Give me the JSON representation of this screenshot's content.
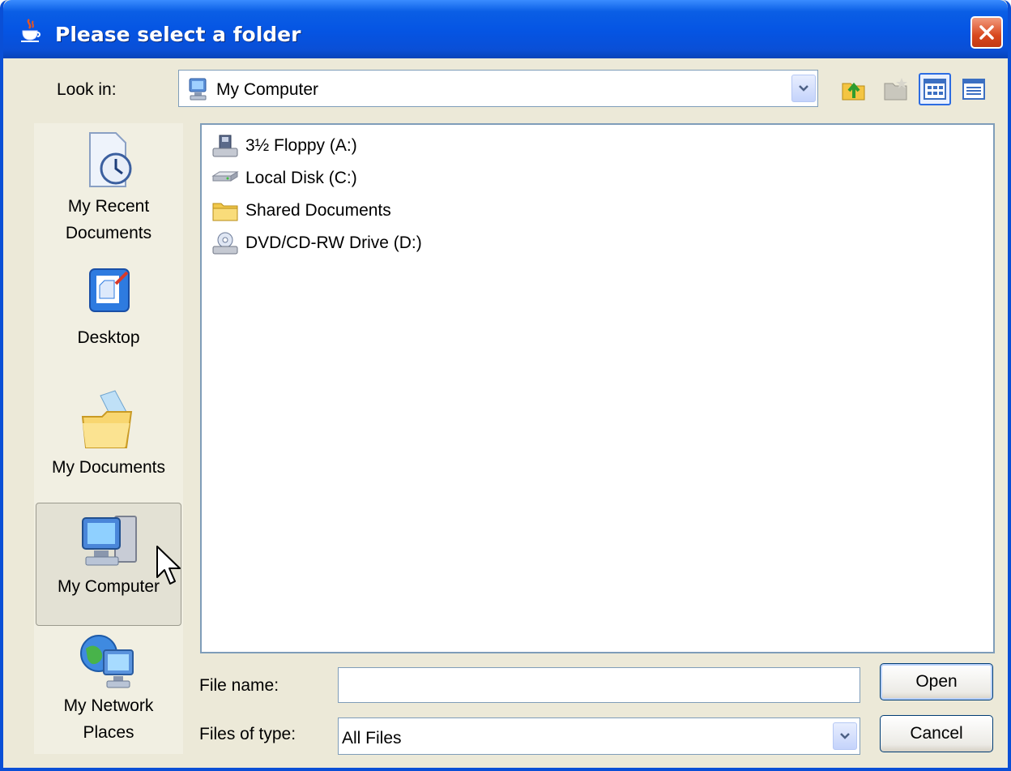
{
  "window": {
    "title": "Please select a folder",
    "colors": {
      "titlebar": "#0a5ee5",
      "body": "#ece9d8",
      "close": "#d9481f"
    }
  },
  "toolbar": {
    "look_in_label": "Look in:",
    "look_in_value": "My Computer",
    "icons": [
      "up-folder-icon",
      "new-folder-icon",
      "list-view-icon",
      "details-view-icon"
    ]
  },
  "places": {
    "items": [
      {
        "label_line1": "My Recent",
        "label_line2": "Documents",
        "icon": "recent-documents-icon"
      },
      {
        "label": "Desktop",
        "icon": "desktop-icon"
      },
      {
        "label": "My Documents",
        "icon": "my-documents-icon"
      },
      {
        "label": "My Computer",
        "icon": "my-computer-icon",
        "selected": true
      },
      {
        "label_line1": "My Network",
        "label_line2": "Places",
        "icon": "network-places-icon"
      }
    ]
  },
  "files": [
    {
      "name": "3½ Floppy (A:)",
      "icon": "floppy-drive-icon"
    },
    {
      "name": "Local Disk (C:)",
      "icon": "hard-disk-icon"
    },
    {
      "name": "Shared Documents",
      "icon": "folder-icon"
    },
    {
      "name": "DVD/CD-RW Drive (D:)",
      "icon": "cd-drive-icon"
    }
  ],
  "bottom": {
    "file_name_label": "File name:",
    "file_name_value": "",
    "files_of_type_label": "Files of type:",
    "files_of_type_value": "All Files",
    "open_label": "Open",
    "cancel_label": "Cancel"
  }
}
